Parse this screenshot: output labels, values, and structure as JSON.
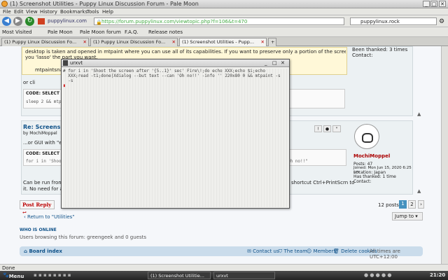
{
  "window": {
    "title": "(1) Screenshot Utilities - Puppy Linux Discussion Forum - Pale Moon"
  },
  "menu": [
    "File",
    "Edit",
    "View",
    "History",
    "Bookmarks",
    "Tools",
    "Help"
  ],
  "nav": {
    "site": "puppylinux.com",
    "url": "https://forum.puppylinux.com/viewtopic.php?f=106&t=470",
    "search": "puppylinux.rock"
  },
  "bookmarks": [
    "Most Visited",
    "Pale Moon",
    "Pale Moon forum",
    "F.A.Q.",
    "Release notes"
  ],
  "tabs": [
    "(1) Puppy Linux Discussion Fo...",
    "(1) Puppy Linux Discussion Fo...",
    "(1) Screenshot Utilities - Pupp..."
  ],
  "post1": {
    "text1": "desktop is taken and opened in mtpaint where you can use all of its capabilities. If you want to preserve only a portion of the screenshot,",
    "text2": "you 'lasso' the part you want.",
    "text3": "mtpaintsna",
    "or_cli": "or cli",
    "code_label": "CODE: SELECT ALL",
    "code": "sleep 2 && mtpaint -s",
    "right1": "Been thanked: 3 times",
    "contact": "Contact:"
  },
  "post2": {
    "title": "Re: Screensh",
    "by": "by MochiMoppel",
    "gui": "...or GUI with \"en",
    "code_label": "CODE: SELECT ALL",
    "code": "for i in 'Shoot",
    "code_right": "trick --can \"Oh no!!\"",
    "run1": "Can be run from",
    "run_right": "shortcut Ctrl+PrintScrn to",
    "run2": "it. No need for a",
    "user": "MochiMoppel",
    "posts": "Posts: 47",
    "joined": "Joined: Mon Jun 15, 2020 6:25 pm",
    "location": "Location: Japan",
    "thanked": "Has thanked: 1 time",
    "contact": "Contact:"
  },
  "postreply": "Post Reply",
  "pagination": {
    "posts": "12 posts",
    "p1": "1",
    "p2": "2"
  },
  "return": "Return to \"Utilities\"",
  "jump": "Jump to",
  "online": {
    "title": "WHO IS ONLINE",
    "text": "Users browsing this forum: greengeek and 0 guests"
  },
  "footer": {
    "index": "Board index",
    "contact": "Contact us",
    "team": "The team",
    "members": "Members",
    "cookies": "Delete cookies",
    "times": "All times are UTC+12:00"
  },
  "status": "Done",
  "taskbar": {
    "menu": "Menu",
    "task1": "(1) Screenshot Utilitie...",
    "task2": "urxvt",
    "clock": "21:20"
  },
  "urxvt": {
    "title": "urxvt",
    "line1": "# for i in 'Shoot the screen after '{5..1}' sec' Fire\\!;do echo XXX;echo $i;echo",
    "line2": "  XXX;read -t1;done|Xdialog --but text --can 'Oh no!!' -info '' 220x80 0 && mtpaint -s",
    "line3": "  -s"
  }
}
